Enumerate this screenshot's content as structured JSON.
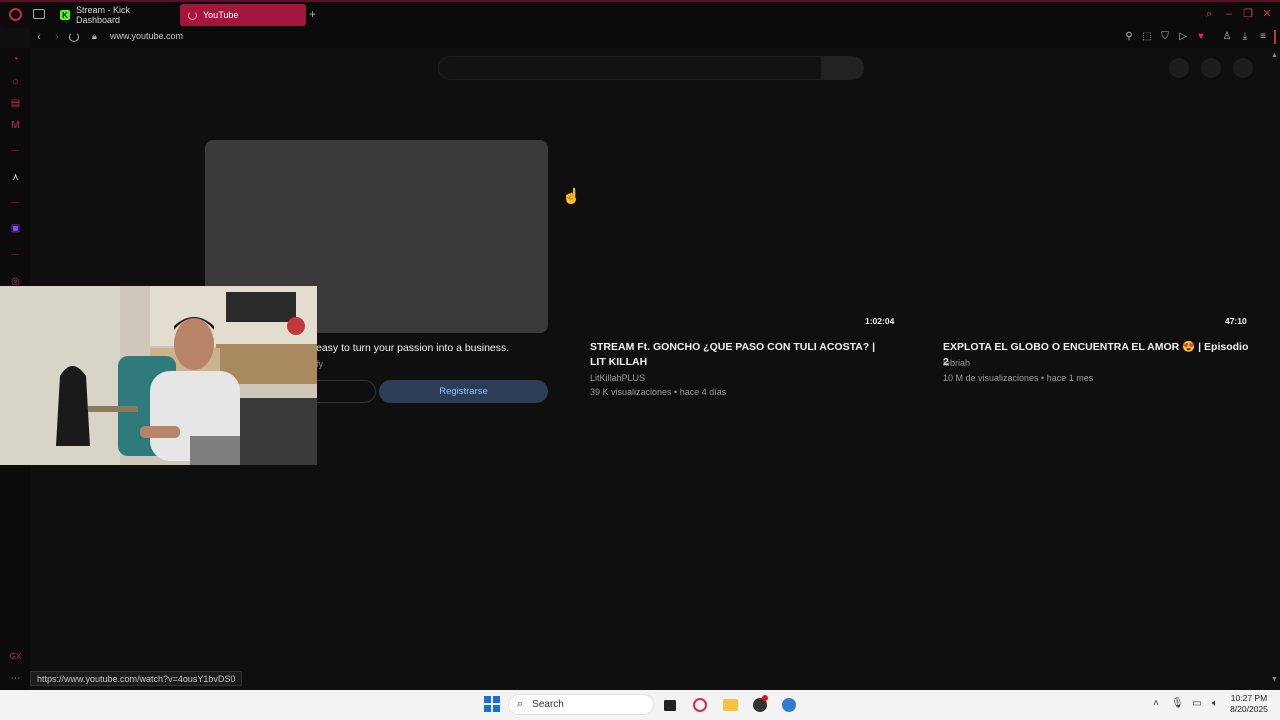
{
  "browser": {
    "tabs": [
      {
        "label": "Stream - Kick Dashboard",
        "active": false
      },
      {
        "label": "YouTube",
        "active": true
      }
    ],
    "url": "www.youtube.com",
    "status_url": "https://www.youtube.com/watch?v=4ousY1bvDS0",
    "accent": "#a3163d"
  },
  "ad": {
    "title": "easy to turn your passion into a business.",
    "sponsor": "fy",
    "cta_label": "Registrarse"
  },
  "videos": [
    {
      "duration": "1:02:04",
      "title": "STREAM Ft. GONCHO ¿QUE PASO CON TULI ACOSTA? | LIT KILLAH",
      "channel": "LitKillahPLUS",
      "meta": "39 K visualizaciones • hace 4 días"
    },
    {
      "duration": "47:10",
      "title": "EXPLOTA EL GLOBO O ENCUENTRA EL AMOR 😍 | Episodio 2",
      "channel": "lebriah",
      "meta": "10 M de visualizaciones • hace 1 mes"
    }
  ],
  "taskbar": {
    "search_label": "Search",
    "time": "10:27 PM",
    "date": "8/20/2025"
  }
}
